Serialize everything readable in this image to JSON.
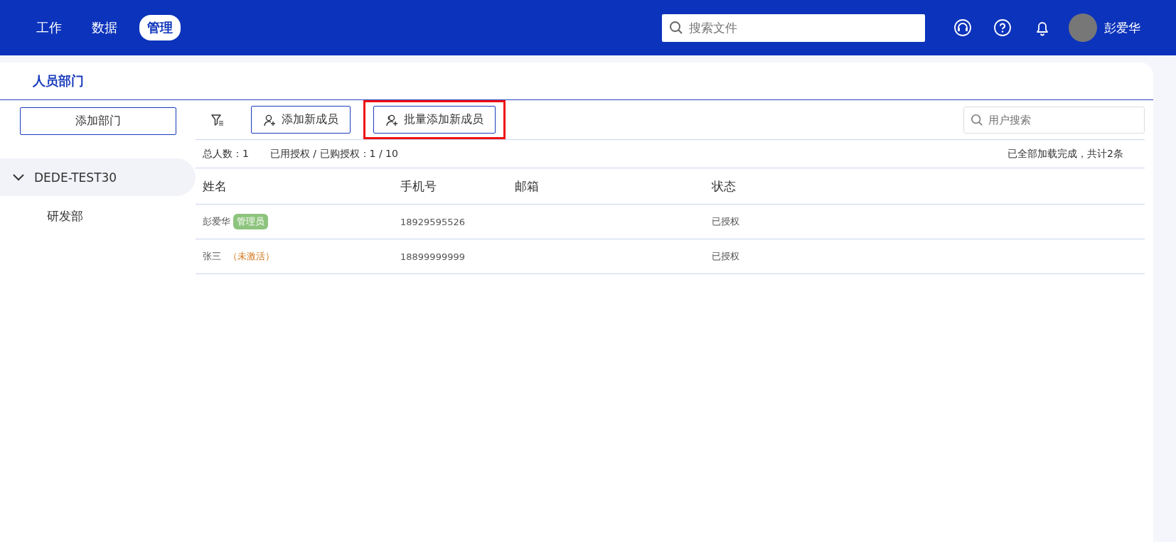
{
  "nav": {
    "tabs": [
      {
        "label": "工作",
        "selected": false
      },
      {
        "label": "数据",
        "selected": false
      },
      {
        "label": "管理",
        "selected": true
      }
    ],
    "search": {
      "placeholder": "搜索文件"
    },
    "user": {
      "name": "彭爱华"
    }
  },
  "page": {
    "title": "人员部门"
  },
  "sidebar": {
    "add_button": "添加部门",
    "tree": [
      {
        "label": "DEDE-TEST30",
        "expanded": true,
        "selected": true,
        "children": [
          {
            "label": "研发部",
            "selected": false
          }
        ]
      }
    ]
  },
  "toolbar": {
    "buttons": [
      {
        "label": "添加新成员",
        "kind": "single",
        "highlighted": false
      },
      {
        "label": "批量添加新成员",
        "kind": "batch",
        "highlighted": true
      }
    ],
    "search": {
      "placeholder": "用户搜索"
    }
  },
  "summary": {
    "total": "总人数：1",
    "license": "已用授权 / 已购授权：1 / 10",
    "loaded": "已全部加载完成，共计2条"
  },
  "table": {
    "columns": [
      "姓名",
      "手机号",
      "邮箱",
      "状态"
    ],
    "rows": [
      {
        "name": "彭爱华",
        "tag": {
          "kind": "admin",
          "text": "管理员"
        },
        "phone": "18929595526",
        "status": "已授权"
      },
      {
        "name": "张三",
        "tag": {
          "kind": "inactive",
          "text": "（未激活）"
        },
        "phone": "18899999999",
        "status": "已授权"
      }
    ]
  }
}
